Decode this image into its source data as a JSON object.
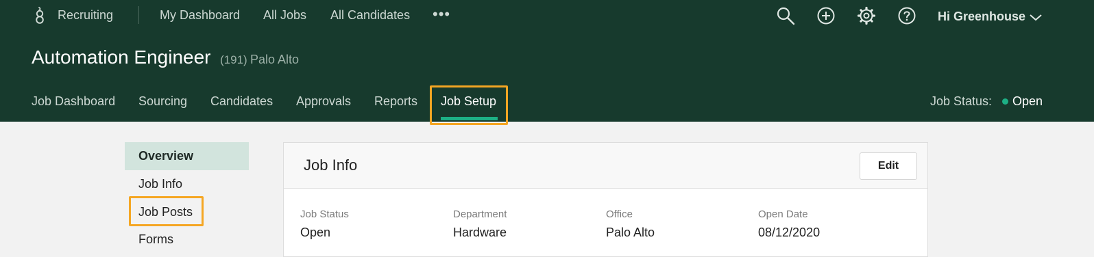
{
  "app": {
    "name": "Recruiting"
  },
  "nav": {
    "links": [
      "My Dashboard",
      "All Jobs",
      "All Candidates"
    ],
    "more_icon": "ellipsis-icon",
    "greeting": "Hi Greenhouse",
    "icons": [
      "search-icon",
      "add-icon",
      "gear-icon",
      "help-icon",
      "chevron-down-icon"
    ]
  },
  "job": {
    "title": "Automation Engineer",
    "count": "(191)",
    "location": "Palo Alto"
  },
  "tabs": [
    {
      "label": "Job Dashboard"
    },
    {
      "label": "Sourcing"
    },
    {
      "label": "Candidates"
    },
    {
      "label": "Approvals"
    },
    {
      "label": "Reports"
    },
    {
      "label": "Job Setup",
      "active": true
    }
  ],
  "job_status": {
    "label": "Job Status:",
    "value": "Open"
  },
  "sidebar": {
    "items": [
      {
        "label": "Overview",
        "active": true
      },
      {
        "label": "Job Info"
      },
      {
        "label": "Job Posts"
      },
      {
        "label": "Forms"
      }
    ]
  },
  "card": {
    "title": "Job Info",
    "edit_label": "Edit",
    "fields": [
      {
        "label": "Job Status",
        "value": "Open"
      },
      {
        "label": "Department",
        "value": "Hardware"
      },
      {
        "label": "Office",
        "value": "Palo Alto"
      },
      {
        "label": "Open Date",
        "value": "08/12/2020"
      }
    ]
  },
  "colors": {
    "header_bg": "#173a2d",
    "accent": "#1db085",
    "highlight": "#f5a623",
    "sidebar_active": "#d2e4dd"
  }
}
